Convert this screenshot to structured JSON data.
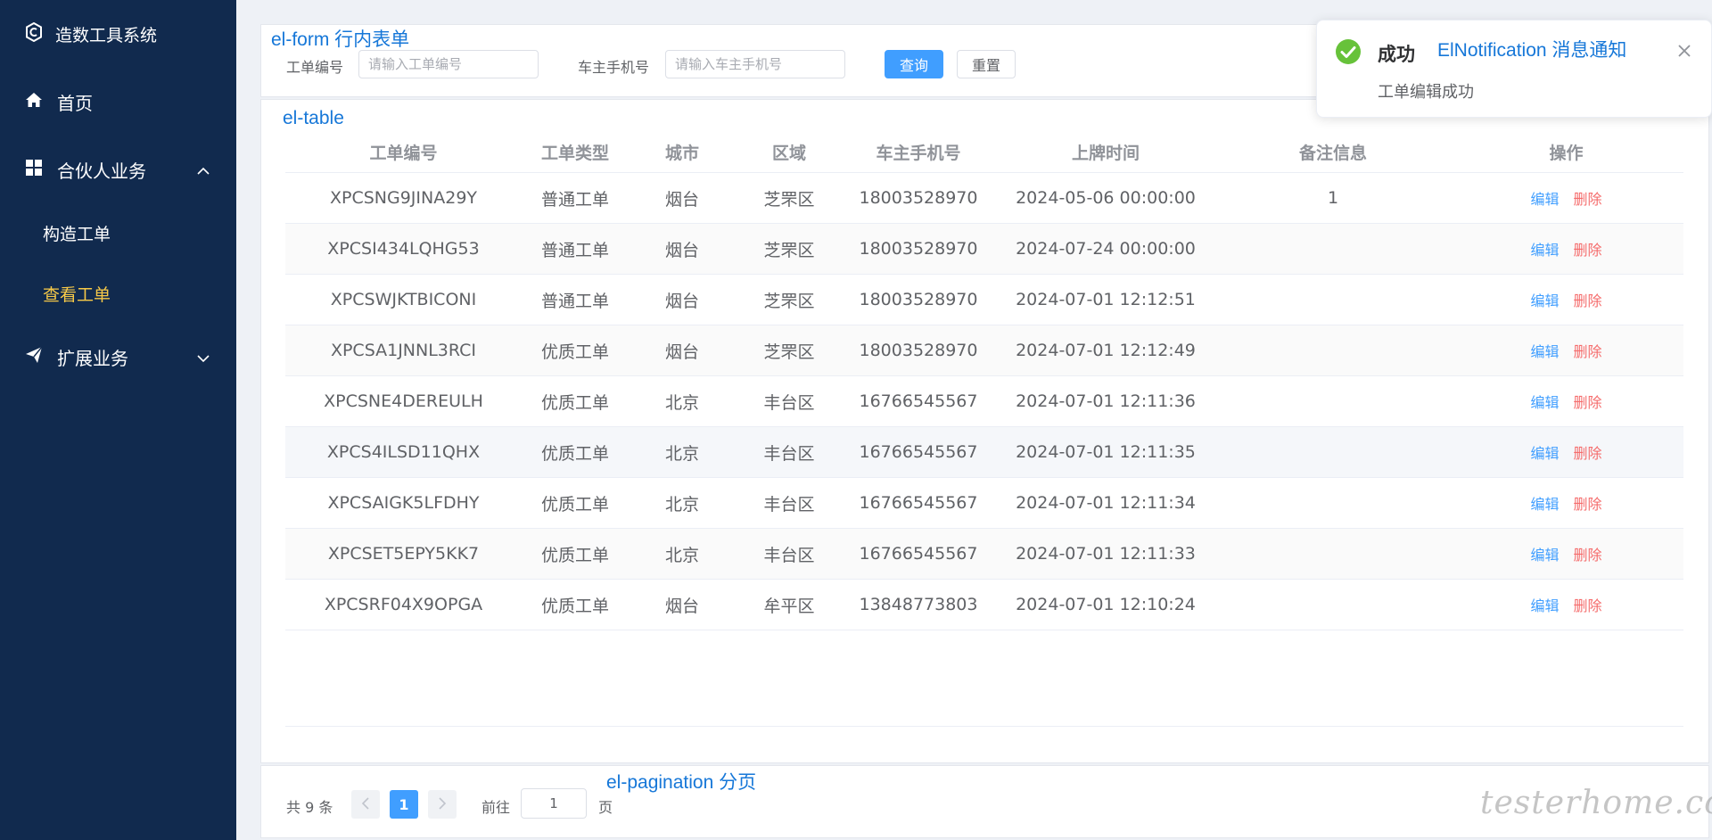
{
  "sidebar": {
    "brand": "造数工具系统",
    "home": "首页",
    "partner": "合伙人业务",
    "partner_items": [
      "构造工单",
      "查看工单"
    ],
    "extend": "扩展业务"
  },
  "annotations": {
    "form": "el-form 行内表单",
    "table": "el-table",
    "pagination": "el-pagination 分页",
    "notification": "ElNotification 消息通知"
  },
  "form": {
    "order_no_label": "工单编号",
    "order_no_placeholder": "请输入工单编号",
    "phone_label": "车主手机号",
    "phone_placeholder": "请输入车主手机号",
    "query_label": "查询",
    "reset_label": "重置"
  },
  "table": {
    "headers": [
      "工单编号",
      "工单类型",
      "城市",
      "区域",
      "车主手机号",
      "上牌时间",
      "备注信息",
      "操作"
    ],
    "edit_label": "编辑",
    "delete_label": "删除",
    "rows": [
      [
        "XPCSNG9JINA29Y",
        "普通工单",
        "烟台",
        "芝罘区",
        "18003528970",
        "2024-05-06 00:00:00",
        "1"
      ],
      [
        "XPCSI434LQHG53",
        "普通工单",
        "烟台",
        "芝罘区",
        "18003528970",
        "2024-07-24 00:00:00",
        ""
      ],
      [
        "XPCSWJKTBICONI",
        "普通工单",
        "烟台",
        "芝罘区",
        "18003528970",
        "2024-07-01 12:12:51",
        ""
      ],
      [
        "XPCSA1JNNL3RCI",
        "优质工单",
        "烟台",
        "芝罘区",
        "18003528970",
        "2024-07-01 12:12:49",
        ""
      ],
      [
        "XPCSNE4DEREULH",
        "优质工单",
        "北京",
        "丰台区",
        "16766545567",
        "2024-07-01 12:11:36",
        ""
      ],
      [
        "XPCS4ILSD11QHX",
        "优质工单",
        "北京",
        "丰台区",
        "16766545567",
        "2024-07-01 12:11:35",
        ""
      ],
      [
        "XPCSAIGK5LFDHY",
        "优质工单",
        "北京",
        "丰台区",
        "16766545567",
        "2024-07-01 12:11:34",
        ""
      ],
      [
        "XPCSET5EPY5KK7",
        "优质工单",
        "北京",
        "丰台区",
        "16766545567",
        "2024-07-01 12:11:33",
        ""
      ],
      [
        "XPCSRF04X9OPGA",
        "优质工单",
        "烟台",
        "牟平区",
        "13848773803",
        "2024-07-01 12:10:24",
        ""
      ]
    ]
  },
  "pagination": {
    "total": "共 9 条",
    "current_page": "1",
    "goto_label": "前往",
    "goto_value": "1",
    "page_unit": "页"
  },
  "notification": {
    "title": "成功",
    "message": "工单编辑成功"
  },
  "watermark": "testerhome.com",
  "colors": {
    "sidebar_bg": "#112a4e",
    "active_menu": "#f7c948",
    "primary": "#409eff",
    "danger": "#f56c6c",
    "success": "#67c23a"
  }
}
